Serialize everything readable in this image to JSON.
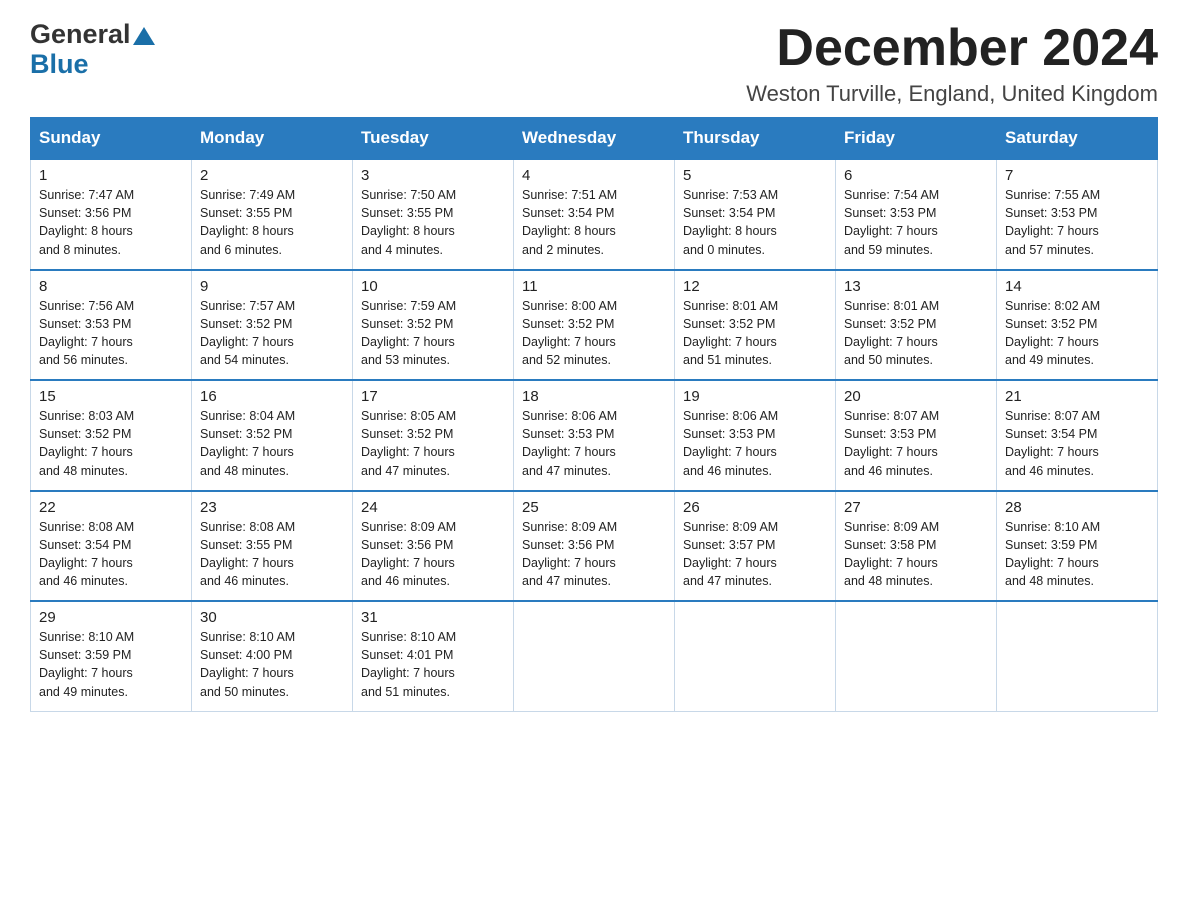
{
  "logo": {
    "general": "General",
    "blue": "Blue",
    "triangle": "▲"
  },
  "header": {
    "month_title": "December 2024",
    "location": "Weston Turville, England, United Kingdom"
  },
  "weekdays": [
    "Sunday",
    "Monday",
    "Tuesday",
    "Wednesday",
    "Thursday",
    "Friday",
    "Saturday"
  ],
  "weeks": [
    [
      {
        "day": "1",
        "sunrise": "7:47 AM",
        "sunset": "3:56 PM",
        "daylight": "8 hours and 8 minutes."
      },
      {
        "day": "2",
        "sunrise": "7:49 AM",
        "sunset": "3:55 PM",
        "daylight": "8 hours and 6 minutes."
      },
      {
        "day": "3",
        "sunrise": "7:50 AM",
        "sunset": "3:55 PM",
        "daylight": "8 hours and 4 minutes."
      },
      {
        "day": "4",
        "sunrise": "7:51 AM",
        "sunset": "3:54 PM",
        "daylight": "8 hours and 2 minutes."
      },
      {
        "day": "5",
        "sunrise": "7:53 AM",
        "sunset": "3:54 PM",
        "daylight": "8 hours and 0 minutes."
      },
      {
        "day": "6",
        "sunrise": "7:54 AM",
        "sunset": "3:53 PM",
        "daylight": "7 hours and 59 minutes."
      },
      {
        "day": "7",
        "sunrise": "7:55 AM",
        "sunset": "3:53 PM",
        "daylight": "7 hours and 57 minutes."
      }
    ],
    [
      {
        "day": "8",
        "sunrise": "7:56 AM",
        "sunset": "3:53 PM",
        "daylight": "7 hours and 56 minutes."
      },
      {
        "day": "9",
        "sunrise": "7:57 AM",
        "sunset": "3:52 PM",
        "daylight": "7 hours and 54 minutes."
      },
      {
        "day": "10",
        "sunrise": "7:59 AM",
        "sunset": "3:52 PM",
        "daylight": "7 hours and 53 minutes."
      },
      {
        "day": "11",
        "sunrise": "8:00 AM",
        "sunset": "3:52 PM",
        "daylight": "7 hours and 52 minutes."
      },
      {
        "day": "12",
        "sunrise": "8:01 AM",
        "sunset": "3:52 PM",
        "daylight": "7 hours and 51 minutes."
      },
      {
        "day": "13",
        "sunrise": "8:01 AM",
        "sunset": "3:52 PM",
        "daylight": "7 hours and 50 minutes."
      },
      {
        "day": "14",
        "sunrise": "8:02 AM",
        "sunset": "3:52 PM",
        "daylight": "7 hours and 49 minutes."
      }
    ],
    [
      {
        "day": "15",
        "sunrise": "8:03 AM",
        "sunset": "3:52 PM",
        "daylight": "7 hours and 48 minutes."
      },
      {
        "day": "16",
        "sunrise": "8:04 AM",
        "sunset": "3:52 PM",
        "daylight": "7 hours and 48 minutes."
      },
      {
        "day": "17",
        "sunrise": "8:05 AM",
        "sunset": "3:52 PM",
        "daylight": "7 hours and 47 minutes."
      },
      {
        "day": "18",
        "sunrise": "8:06 AM",
        "sunset": "3:53 PM",
        "daylight": "7 hours and 47 minutes."
      },
      {
        "day": "19",
        "sunrise": "8:06 AM",
        "sunset": "3:53 PM",
        "daylight": "7 hours and 46 minutes."
      },
      {
        "day": "20",
        "sunrise": "8:07 AM",
        "sunset": "3:53 PM",
        "daylight": "7 hours and 46 minutes."
      },
      {
        "day": "21",
        "sunrise": "8:07 AM",
        "sunset": "3:54 PM",
        "daylight": "7 hours and 46 minutes."
      }
    ],
    [
      {
        "day": "22",
        "sunrise": "8:08 AM",
        "sunset": "3:54 PM",
        "daylight": "7 hours and 46 minutes."
      },
      {
        "day": "23",
        "sunrise": "8:08 AM",
        "sunset": "3:55 PM",
        "daylight": "7 hours and 46 minutes."
      },
      {
        "day": "24",
        "sunrise": "8:09 AM",
        "sunset": "3:56 PM",
        "daylight": "7 hours and 46 minutes."
      },
      {
        "day": "25",
        "sunrise": "8:09 AM",
        "sunset": "3:56 PM",
        "daylight": "7 hours and 47 minutes."
      },
      {
        "day": "26",
        "sunrise": "8:09 AM",
        "sunset": "3:57 PM",
        "daylight": "7 hours and 47 minutes."
      },
      {
        "day": "27",
        "sunrise": "8:09 AM",
        "sunset": "3:58 PM",
        "daylight": "7 hours and 48 minutes."
      },
      {
        "day": "28",
        "sunrise": "8:10 AM",
        "sunset": "3:59 PM",
        "daylight": "7 hours and 48 minutes."
      }
    ],
    [
      {
        "day": "29",
        "sunrise": "8:10 AM",
        "sunset": "3:59 PM",
        "daylight": "7 hours and 49 minutes."
      },
      {
        "day": "30",
        "sunrise": "8:10 AM",
        "sunset": "4:00 PM",
        "daylight": "7 hours and 50 minutes."
      },
      {
        "day": "31",
        "sunrise": "8:10 AM",
        "sunset": "4:01 PM",
        "daylight": "7 hours and 51 minutes."
      },
      null,
      null,
      null,
      null
    ]
  ],
  "labels": {
    "sunrise": "Sunrise:",
    "sunset": "Sunset:",
    "daylight": "Daylight:"
  }
}
